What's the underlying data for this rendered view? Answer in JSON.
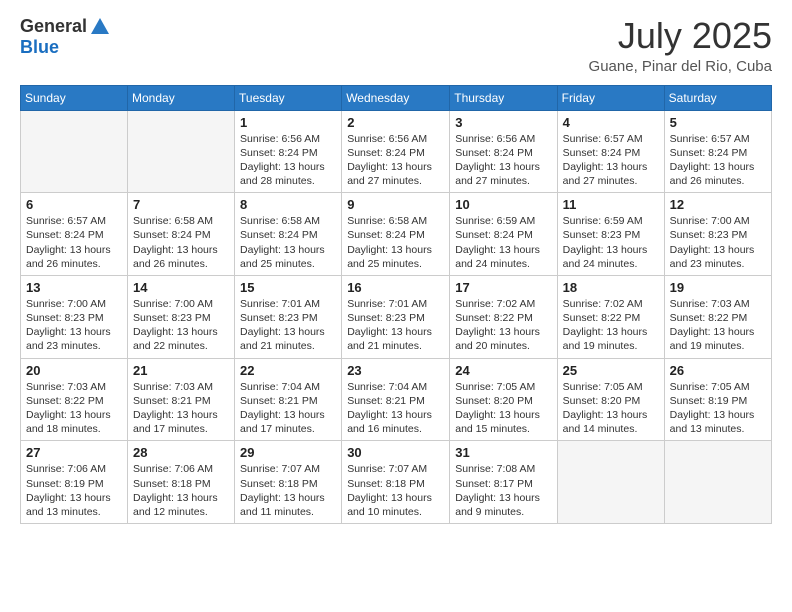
{
  "header": {
    "logo_line1": "General",
    "logo_line2": "Blue",
    "month_year": "July 2025",
    "location": "Guane, Pinar del Rio, Cuba"
  },
  "days_of_week": [
    "Sunday",
    "Monday",
    "Tuesday",
    "Wednesday",
    "Thursday",
    "Friday",
    "Saturday"
  ],
  "weeks": [
    [
      {
        "day": "",
        "info": ""
      },
      {
        "day": "",
        "info": ""
      },
      {
        "day": "1",
        "info": "Sunrise: 6:56 AM\nSunset: 8:24 PM\nDaylight: 13 hours and 28 minutes."
      },
      {
        "day": "2",
        "info": "Sunrise: 6:56 AM\nSunset: 8:24 PM\nDaylight: 13 hours and 27 minutes."
      },
      {
        "day": "3",
        "info": "Sunrise: 6:56 AM\nSunset: 8:24 PM\nDaylight: 13 hours and 27 minutes."
      },
      {
        "day": "4",
        "info": "Sunrise: 6:57 AM\nSunset: 8:24 PM\nDaylight: 13 hours and 27 minutes."
      },
      {
        "day": "5",
        "info": "Sunrise: 6:57 AM\nSunset: 8:24 PM\nDaylight: 13 hours and 26 minutes."
      }
    ],
    [
      {
        "day": "6",
        "info": "Sunrise: 6:57 AM\nSunset: 8:24 PM\nDaylight: 13 hours and 26 minutes."
      },
      {
        "day": "7",
        "info": "Sunrise: 6:58 AM\nSunset: 8:24 PM\nDaylight: 13 hours and 26 minutes."
      },
      {
        "day": "8",
        "info": "Sunrise: 6:58 AM\nSunset: 8:24 PM\nDaylight: 13 hours and 25 minutes."
      },
      {
        "day": "9",
        "info": "Sunrise: 6:58 AM\nSunset: 8:24 PM\nDaylight: 13 hours and 25 minutes."
      },
      {
        "day": "10",
        "info": "Sunrise: 6:59 AM\nSunset: 8:24 PM\nDaylight: 13 hours and 24 minutes."
      },
      {
        "day": "11",
        "info": "Sunrise: 6:59 AM\nSunset: 8:23 PM\nDaylight: 13 hours and 24 minutes."
      },
      {
        "day": "12",
        "info": "Sunrise: 7:00 AM\nSunset: 8:23 PM\nDaylight: 13 hours and 23 minutes."
      }
    ],
    [
      {
        "day": "13",
        "info": "Sunrise: 7:00 AM\nSunset: 8:23 PM\nDaylight: 13 hours and 23 minutes."
      },
      {
        "day": "14",
        "info": "Sunrise: 7:00 AM\nSunset: 8:23 PM\nDaylight: 13 hours and 22 minutes."
      },
      {
        "day": "15",
        "info": "Sunrise: 7:01 AM\nSunset: 8:23 PM\nDaylight: 13 hours and 21 minutes."
      },
      {
        "day": "16",
        "info": "Sunrise: 7:01 AM\nSunset: 8:23 PM\nDaylight: 13 hours and 21 minutes."
      },
      {
        "day": "17",
        "info": "Sunrise: 7:02 AM\nSunset: 8:22 PM\nDaylight: 13 hours and 20 minutes."
      },
      {
        "day": "18",
        "info": "Sunrise: 7:02 AM\nSunset: 8:22 PM\nDaylight: 13 hours and 19 minutes."
      },
      {
        "day": "19",
        "info": "Sunrise: 7:03 AM\nSunset: 8:22 PM\nDaylight: 13 hours and 19 minutes."
      }
    ],
    [
      {
        "day": "20",
        "info": "Sunrise: 7:03 AM\nSunset: 8:22 PM\nDaylight: 13 hours and 18 minutes."
      },
      {
        "day": "21",
        "info": "Sunrise: 7:03 AM\nSunset: 8:21 PM\nDaylight: 13 hours and 17 minutes."
      },
      {
        "day": "22",
        "info": "Sunrise: 7:04 AM\nSunset: 8:21 PM\nDaylight: 13 hours and 17 minutes."
      },
      {
        "day": "23",
        "info": "Sunrise: 7:04 AM\nSunset: 8:21 PM\nDaylight: 13 hours and 16 minutes."
      },
      {
        "day": "24",
        "info": "Sunrise: 7:05 AM\nSunset: 8:20 PM\nDaylight: 13 hours and 15 minutes."
      },
      {
        "day": "25",
        "info": "Sunrise: 7:05 AM\nSunset: 8:20 PM\nDaylight: 13 hours and 14 minutes."
      },
      {
        "day": "26",
        "info": "Sunrise: 7:05 AM\nSunset: 8:19 PM\nDaylight: 13 hours and 13 minutes."
      }
    ],
    [
      {
        "day": "27",
        "info": "Sunrise: 7:06 AM\nSunset: 8:19 PM\nDaylight: 13 hours and 13 minutes."
      },
      {
        "day": "28",
        "info": "Sunrise: 7:06 AM\nSunset: 8:18 PM\nDaylight: 13 hours and 12 minutes."
      },
      {
        "day": "29",
        "info": "Sunrise: 7:07 AM\nSunset: 8:18 PM\nDaylight: 13 hours and 11 minutes."
      },
      {
        "day": "30",
        "info": "Sunrise: 7:07 AM\nSunset: 8:18 PM\nDaylight: 13 hours and 10 minutes."
      },
      {
        "day": "31",
        "info": "Sunrise: 7:08 AM\nSunset: 8:17 PM\nDaylight: 13 hours and 9 minutes."
      },
      {
        "day": "",
        "info": ""
      },
      {
        "day": "",
        "info": ""
      }
    ]
  ]
}
